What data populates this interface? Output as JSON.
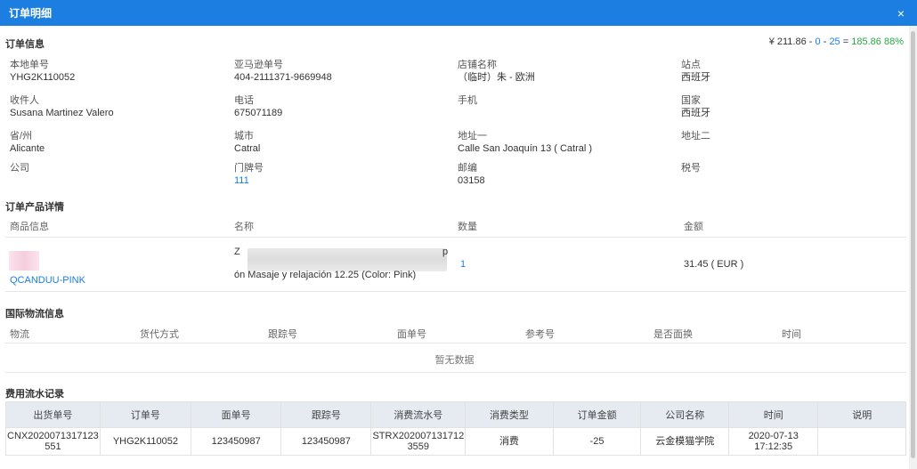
{
  "dialog": {
    "title": "订单明细",
    "close_icon": "×"
  },
  "order_info": {
    "section_title": "订单信息",
    "summary": {
      "price": "¥ 211.86",
      "sep1": "-",
      "value1": "0",
      "sep2": "-",
      "value2": "25",
      "eq": "=",
      "result": "185.86",
      "percent": "88%"
    },
    "fields": [
      {
        "label": "本地单号",
        "value": "YHG2K110052"
      },
      {
        "label": "亚马逊单号",
        "value": "404-2111371-9669948"
      },
      {
        "label": "店铺名称",
        "value": "（临时）朱 - 欧洲"
      },
      {
        "label": "站点",
        "value": "西班牙"
      },
      {
        "label": "收件人",
        "value": "Susana Martinez Valero"
      },
      {
        "label": "电话",
        "value": "675071189"
      },
      {
        "label": "手机",
        "value": ""
      },
      {
        "label": "国家",
        "value": "西班牙"
      },
      {
        "label": "省/州",
        "value": "Alicante"
      },
      {
        "label": "城市",
        "value": "Catral"
      },
      {
        "label": "地址一",
        "value": "Calle San Joaquín 13 ( Catral )"
      },
      {
        "label": "地址二",
        "value": ""
      },
      {
        "label": "公司",
        "value": ""
      },
      {
        "label": "门牌号",
        "value": "111"
      },
      {
        "label": "邮编",
        "value": "03158"
      },
      {
        "label": "税号",
        "value": ""
      }
    ]
  },
  "products": {
    "section_title": "订单产品详情",
    "headers": [
      "商品信息",
      "名称",
      "数量",
      "金额"
    ],
    "row": {
      "sku": "QCANDUU-PINK",
      "name_line1": "Z",
      "name_line2": "p",
      "name_line3": "ón Masaje y relajación 12.25 (Color: Pink)",
      "quantity": "1",
      "amount": "31.45 ( EUR )"
    }
  },
  "logistics": {
    "section_title": "国际物流信息",
    "headers": [
      "物流",
      "货代方式",
      "跟踪号",
      "面单号",
      "参考号",
      "是否面换",
      "时间"
    ],
    "empty_text": "暂无数据"
  },
  "fees": {
    "section_title": "费用流水记录",
    "headers": [
      "出货单号",
      "订单号",
      "面单号",
      "跟踪号",
      "消费流水号",
      "消费类型",
      "订单金额",
      "公司名称",
      "时间",
      "说明"
    ],
    "row": {
      "shipment_no": "CNX2020071317123 551",
      "order_no": "YHG2K110052",
      "label_no": "123450987",
      "tracking_no": "123450987",
      "txn_no": "STRX202007131712 3559",
      "txn_type": "消费",
      "amount": "-25",
      "company": "云金模猫学院",
      "time": "2020-07-13 17:12:35",
      "note": ""
    }
  }
}
